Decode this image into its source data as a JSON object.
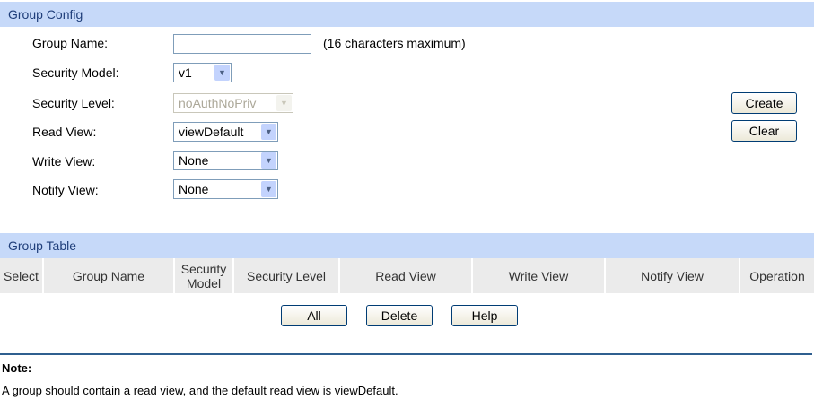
{
  "config": {
    "title": "Group Config",
    "group_name_label": "Group Name:",
    "group_name_value": "",
    "group_name_hint": "(16 characters maximum)",
    "security_model_label": "Security Model:",
    "security_model_value": "v1",
    "security_level_label": "Security Level:",
    "security_level_value": "noAuthNoPriv",
    "read_view_label": "Read View:",
    "read_view_value": "viewDefault",
    "write_view_label": "Write View:",
    "write_view_value": "None",
    "notify_view_label": "Notify View:",
    "notify_view_value": "None",
    "create_label": "Create",
    "clear_label": "Clear"
  },
  "table": {
    "title": "Group Table",
    "columns": [
      "Select",
      "Group Name",
      "Security Model",
      "Security Level",
      "Read View",
      "Write View",
      "Notify View",
      "Operation"
    ],
    "all_label": "All",
    "delete_label": "Delete",
    "help_label": "Help"
  },
  "note": {
    "title": "Note:",
    "text": "A group should contain a read view, and the default read view is viewDefault."
  }
}
